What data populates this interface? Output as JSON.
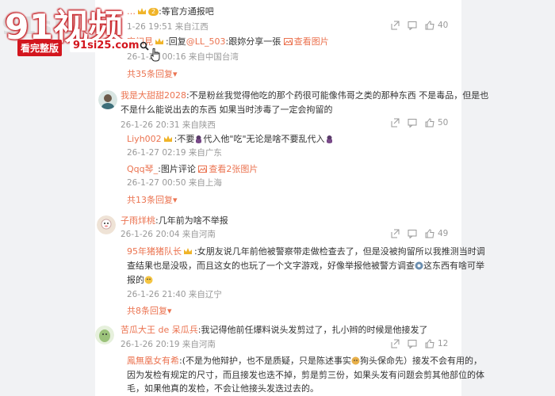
{
  "watermark": {
    "title": "91视频",
    "faint": "91si2",
    "badge": "看完整版",
    "site": "91si25.com"
  },
  "comments": [
    {
      "reply_text": ":等官方通报吧",
      "meta": "1-26 19:51 来自江西",
      "likes": "40"
    },
    {
      "user": "宋初見",
      "prefix": ":回复",
      "mention": "@LL_503",
      "text": ":跟妳分享一張",
      "pic_link": "查看图片",
      "meta": "26-1-27 00:16 来自中国台湾"
    },
    {
      "more": "共35条回复",
      "more_arrow": "▾"
    },
    {
      "user": "我是大甜甜2028",
      "text_line1": ":不是粉丝我觉得他吃的那个药很可能像伟哥之类的那种东西 不是毒品，但是也",
      "text_line2": "不是什么能说出去的东西  如果当时涉毒了一定会拘留的",
      "meta": "26-1-26 20:31 来自陕西",
      "likes": "50"
    },
    {
      "user": "Liyh002",
      "text": ":不要",
      "text2": "代入他\"吃\"无论是啥不要乱代入",
      "meta": "26-1-27 02:19 来自广东"
    },
    {
      "user": "Qqq琴_",
      "text": ":图片评论",
      "pic_link": "查看2张图片",
      "meta": "26-1-27 00:50 来自上海"
    },
    {
      "more": "共13条回复",
      "more_arrow": "▾"
    },
    {
      "user": "子雨烊桃",
      "text": ":几年前为啥不举报",
      "meta": "26-1-26 20:04 来自河南",
      "likes": "49"
    },
    {
      "user": "95年猪猪队长",
      "text_line1": ":女朋友说几年前他被警察带走做检查去了，但是没被拘留所以我推测当时调",
      "text_line2_a": "查结果也是没吸，而且这女的也玩了一个文字游戏，好像举报他被警方调查",
      "text_line2_b": "这东西有啥可举",
      "text_line3": "报的",
      "meta": "26-1-26 21:40 来自辽宁"
    },
    {
      "more": "共8条回复",
      "more_arrow": "▾"
    },
    {
      "user": "苦瓜大王 de 呆瓜兵",
      "text": ":我记得他前任爆料说头发剪过了，扎小辫的时候是他接发了",
      "meta": "26-1-26 20:19 来自河南",
      "likes": "12"
    },
    {
      "user": "鳳無凰女有希",
      "text_line1_a": ":(不是为他辩护，也不是质疑，只是陈述事实",
      "text_line1_b": "狗头保命先）接发不会有用的，",
      "text_line2": "因为发检有规定的尺寸，而且接发也迭不掉，剪是剪三份，如果头发有问题会剪其他部位的体",
      "text_line3": "毛，如果他真的发检，不会让他接头发迭过去的。"
    }
  ],
  "colors": {
    "accent": "#eb7350",
    "watermark_red": "#d3161e",
    "text": "#333333",
    "meta": "#999999",
    "background": "#f1f2f4"
  }
}
